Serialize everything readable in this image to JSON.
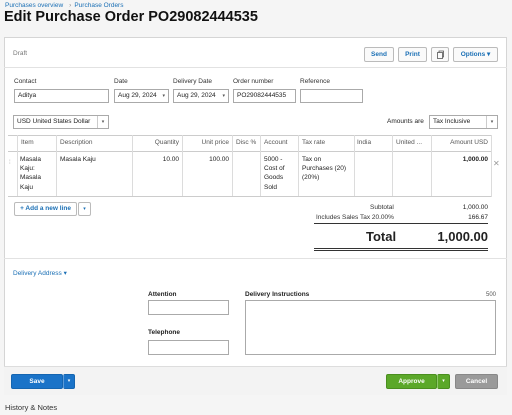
{
  "breadcrumb": {
    "items": [
      "Purchases overview",
      "Purchase Orders"
    ],
    "separator": "›"
  },
  "page": {
    "title": "Edit Purchase Order PO29082444535",
    "status": "Draft"
  },
  "toolbar": {
    "send": "Send",
    "print": "Print",
    "copy_icon": "copy-icon",
    "options": "Options ▾"
  },
  "form": {
    "contact_label": "Contact",
    "contact_value": "Aditya",
    "date_label": "Date",
    "date_value": "Aug 29, 2024",
    "delivery_date_label": "Delivery Date",
    "delivery_date_value": "Aug 29, 2024",
    "order_number_label": "Order number",
    "order_number_value": "PO29082444535",
    "reference_label": "Reference",
    "reference_value": "",
    "currency": "USD United States Dollar",
    "amounts_are_label": "Amounts are",
    "amounts_are_value": "Tax Inclusive"
  },
  "table": {
    "headers": [
      "Item",
      "Description",
      "Quantity",
      "Unit price",
      "Disc %",
      "Account",
      "Tax rate",
      "India",
      "United ...",
      "Amount USD"
    ],
    "rows": [
      {
        "item": "Masala Kaju: Masala Kaju",
        "description": "Masala Kaju",
        "quantity": "10.00",
        "unit_price": "100.00",
        "disc": "",
        "account": "5000 - Cost of Goods Sold",
        "tax_rate": "Tax on Purchases (20) (20%)",
        "india": "",
        "united": "",
        "amount": "1,000.00"
      }
    ]
  },
  "add_line": {
    "label": "+ Add a new line",
    "caret": "▾"
  },
  "totals": {
    "subtotal_label": "Subtotal",
    "subtotal_value": "1,000.00",
    "tax_label": "Includes Sales Tax 20.00%",
    "tax_value": "166.67",
    "total_label": "Total",
    "total_value": "1,000.00"
  },
  "delivery": {
    "toggle": "Delivery Address ▾",
    "attention_label": "Attention",
    "attention_value": "",
    "telephone_label": "Telephone",
    "telephone_value": "",
    "instructions_label": "Delivery Instructions",
    "instructions_count": "500",
    "instructions_value": ""
  },
  "footer": {
    "save": "Save",
    "approve": "Approve",
    "cancel": "Cancel",
    "caret": "▾"
  },
  "history": {
    "label": "History & Notes"
  },
  "colors": {
    "link": "#1a6fb5",
    "save": "#1a73c8",
    "approve": "#5ba829",
    "cancel": "#9a9a9a"
  }
}
